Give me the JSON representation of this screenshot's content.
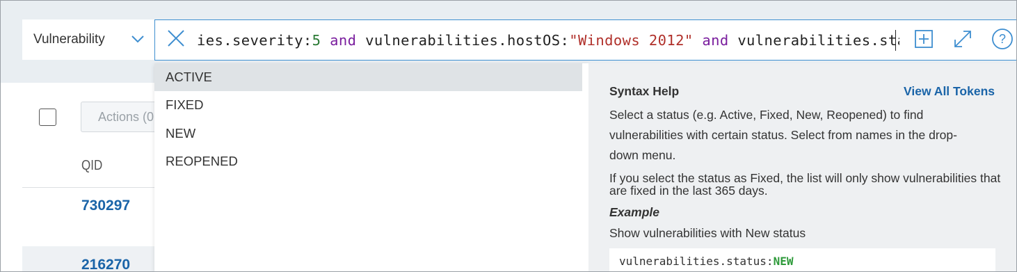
{
  "search": {
    "category": "Vulnerability",
    "query_parts": [
      {
        "text": "ies.severity:",
        "kind": "field"
      },
      {
        "text": "5",
        "kind": "num"
      },
      {
        "text": " and ",
        "kind": "kw"
      },
      {
        "text": "vulnerabilities.hostOS:",
        "kind": "field"
      },
      {
        "text": "\"Windows 2012\"",
        "kind": "str"
      },
      {
        "text": " and ",
        "kind": "kw"
      },
      {
        "text": "vulnerabilities.status:",
        "kind": "field"
      }
    ]
  },
  "toolbar": {
    "icons": [
      "add-icon",
      "expand-icon",
      "help-icon"
    ]
  },
  "table": {
    "actions_label": "Actions (0",
    "column_header": "QID",
    "rows": [
      "730297",
      "216270"
    ]
  },
  "dropdown": {
    "options": [
      "ACTIVE",
      "FIXED",
      "NEW",
      "REOPENED"
    ],
    "highlighted_index": 0
  },
  "syntax_help": {
    "title": "Syntax Help",
    "link": "View All Tokens",
    "paragraph1": "Select a status (e.g. Active, Fixed, New, Reopened) to find vulnerabilities with certain status. Select from names in the drop-down menu.",
    "paragraph2": "If you select the status as Fixed, the list will only show vulnerabilities that are fixed in the last 365 days.",
    "example_label": "Example",
    "example_desc": "Show vulnerabilities with New status",
    "code_prefix": "vulnerabilities.status:",
    "code_value": "NEW"
  },
  "colors": {
    "link": "#1a64a8",
    "keyword": "#7a1e9e",
    "string": "#b0302a",
    "number": "#2a7a34"
  }
}
